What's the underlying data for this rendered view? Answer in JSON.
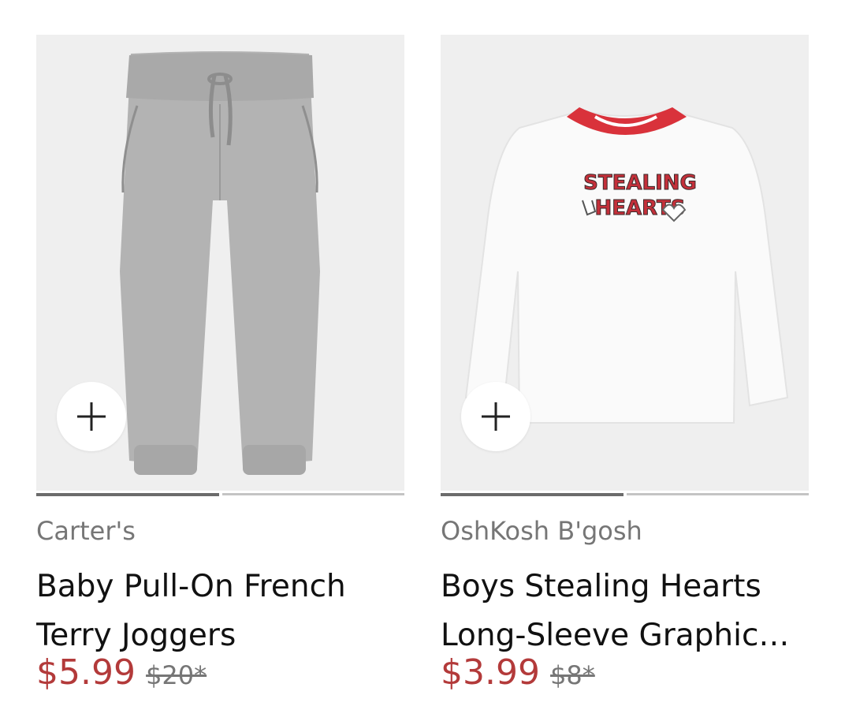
{
  "products": [
    {
      "brand": "Carter's",
      "title_line1": "Baby Pull-On French",
      "title_line2": "Terry Joggers",
      "price": "$5.99",
      "original_price": "$20*",
      "image_icon": "gray-joggers-image",
      "carousel": {
        "total": 2,
        "active": 1
      }
    },
    {
      "brand": "OshKosh B'gosh",
      "title_line1": "Boys Stealing Hearts",
      "title_line2": "Long-Sleeve Graphic…",
      "price": "$3.99",
      "original_price": "$8*",
      "image_icon": "stealing-hearts-tee-image",
      "graphic_line1": "STEALING",
      "graphic_line2": "HEARTS",
      "carousel": {
        "total": 2,
        "active": 1
      }
    }
  ],
  "colors": {
    "price": "#b33a3a",
    "brand": "#767676",
    "title": "#111111",
    "image_bg": "#efefef",
    "carousel_active": "#6b6b6b",
    "carousel_inactive": "#c4c4c4"
  }
}
